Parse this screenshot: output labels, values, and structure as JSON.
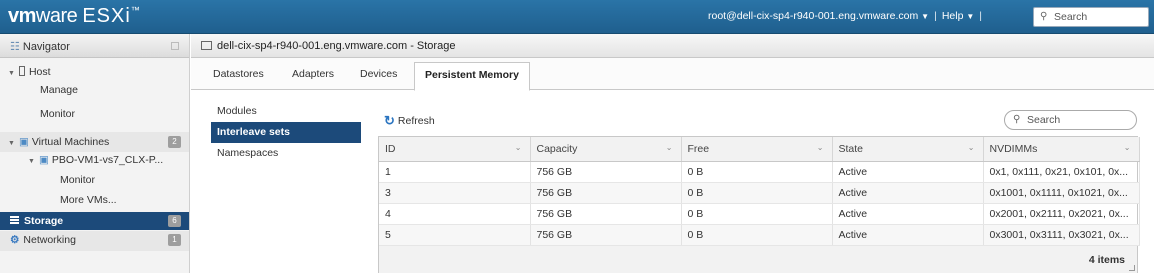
{
  "topbar": {
    "brand_vm": "vm",
    "brand_ware": "ware",
    "brand_product": "ESXi",
    "brand_tm": "™",
    "user": "root@dell-cix-sp4-r940-001.eng.vmware.com",
    "separator": "|",
    "help": "Help",
    "search_placeholder": "Search"
  },
  "navigator": {
    "title": "Navigator",
    "items": [
      {
        "label": "Host"
      },
      {
        "label": "Manage"
      },
      {
        "label": "Monitor"
      },
      {
        "label": "Virtual Machines",
        "badge": "2"
      },
      {
        "label": "PBO-VM1-vs7_CLX-P..."
      },
      {
        "label": "Monitor"
      },
      {
        "label": "More VMs..."
      },
      {
        "label": "Storage",
        "badge": "6"
      },
      {
        "label": "Networking",
        "badge": "1"
      }
    ]
  },
  "main": {
    "breadcrumb": "dell-cix-sp4-r940-001.eng.vmware.com - Storage",
    "tabs": [
      {
        "label": "Datastores"
      },
      {
        "label": "Adapters"
      },
      {
        "label": "Devices"
      },
      {
        "label": "Persistent Memory",
        "active": true
      }
    ],
    "subnav": [
      {
        "label": "Modules"
      },
      {
        "label": "Interleave sets",
        "selected": true
      },
      {
        "label": "Namespaces"
      }
    ],
    "refresh_label": "Refresh",
    "search_placeholder": "Search",
    "table": {
      "columns": [
        "ID",
        "Capacity",
        "Free",
        "State",
        "NVDIMMs"
      ],
      "rows": [
        [
          "1",
          "756 GB",
          "0 B",
          "Active",
          "0x1, 0x111, 0x21, 0x101, 0x..."
        ],
        [
          "3",
          "756 GB",
          "0 B",
          "Active",
          "0x1001, 0x1111, 0x1021, 0x..."
        ],
        [
          "4",
          "756 GB",
          "0 B",
          "Active",
          "0x2001, 0x2111, 0x2021, 0x..."
        ],
        [
          "5",
          "756 GB",
          "0 B",
          "Active",
          "0x3001, 0x3111, 0x3021, 0x..."
        ]
      ],
      "footer": "4 items"
    }
  },
  "colors": {
    "topbar": "#2a74a7",
    "selected": "#1c4a7a",
    "badge": "#9e9e9e"
  }
}
